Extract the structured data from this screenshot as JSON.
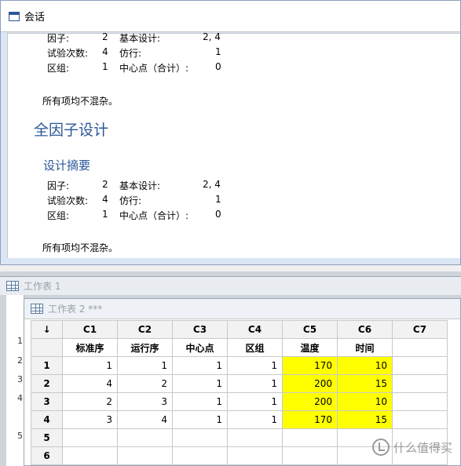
{
  "session": {
    "title": "会话",
    "block1": {
      "factor_label": "因子:",
      "factor_value": "2",
      "base_label": "基本设计:",
      "base_value": "2, 4",
      "runs_label": "试验次数:",
      "runs_value": "4",
      "reps_label": "仿行:",
      "reps_value": "1",
      "blocks_label": "区组:",
      "blocks_value": "1",
      "center_label": "中心点（合计）:",
      "center_value": "0",
      "note": "所有项均不混杂。"
    },
    "heading": "全因子设计",
    "subheading": "设计摘要",
    "block2": {
      "factor_label": "因子:",
      "factor_value": "2",
      "base_label": "基本设计:",
      "base_value": "2, 4",
      "runs_label": "试验次数:",
      "runs_value": "4",
      "reps_label": "仿行:",
      "reps_value": "1",
      "blocks_label": "区组:",
      "blocks_value": "1",
      "center_label": "中心点（合计）:",
      "center_value": "0",
      "note": "所有项均不混杂。"
    }
  },
  "worksheet1": {
    "title": "工作表 1",
    "row_nums": [
      "1",
      "2",
      "3",
      "4",
      "5"
    ]
  },
  "worksheet2": {
    "title": "工作表 2 ***",
    "corner": "↓",
    "columns": [
      "C1",
      "C2",
      "C3",
      "C4",
      "C5",
      "C6",
      "C7"
    ],
    "names": [
      "标准序",
      "运行序",
      "中心点",
      "区组",
      "温度",
      "时间",
      ""
    ],
    "row_labels": [
      "1",
      "2",
      "3",
      "4",
      "5",
      "6"
    ],
    "rows": [
      [
        "1",
        "1",
        "1",
        "1",
        "170",
        "10",
        ""
      ],
      [
        "4",
        "2",
        "1",
        "1",
        "200",
        "15",
        ""
      ],
      [
        "2",
        "3",
        "1",
        "1",
        "200",
        "10",
        ""
      ],
      [
        "3",
        "4",
        "1",
        "1",
        "170",
        "15",
        ""
      ],
      [
        "",
        "",
        "",
        "",
        "",
        "",
        ""
      ],
      [
        "",
        "",
        "",
        "",
        "",
        "",
        ""
      ]
    ],
    "highlight_color": "#ffff00"
  },
  "watermark": {
    "text": "什么值得买"
  }
}
